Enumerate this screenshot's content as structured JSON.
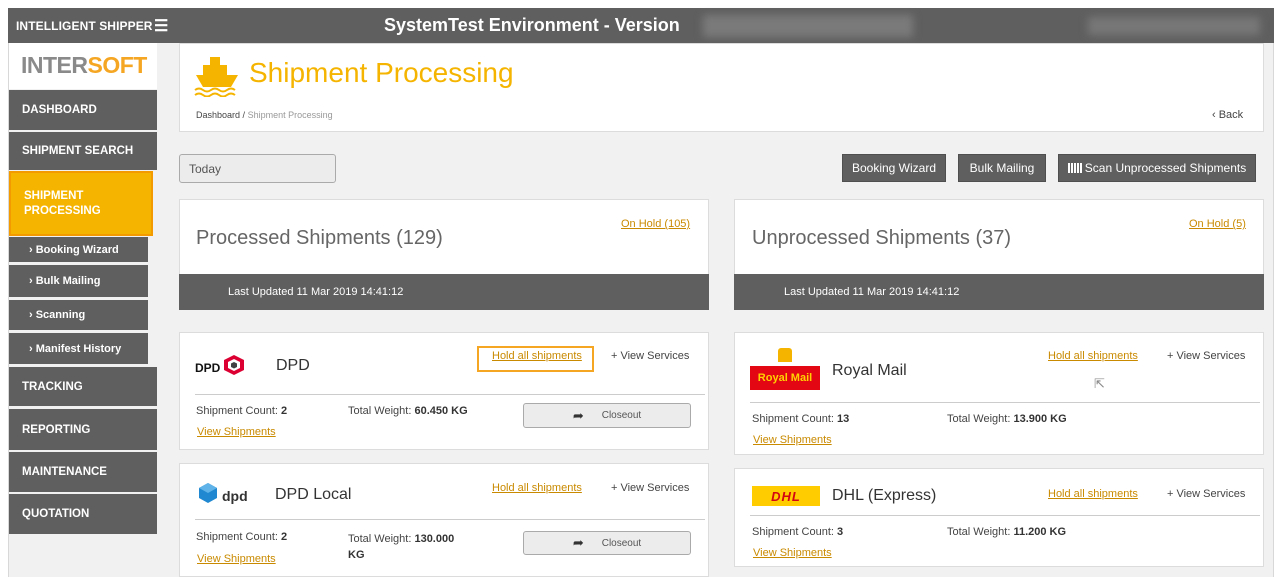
{
  "topbar": {
    "app_name": "INTELLIGENT SHIPPER",
    "menu_icon": "hamburger-icon",
    "env_title": "SystemTest Environment - Version"
  },
  "logo": {
    "part1": "INTER",
    "part2": "SOFT"
  },
  "sidebar": {
    "items": [
      {
        "label": "DASHBOARD"
      },
      {
        "label": "SHIPMENT SEARCH"
      },
      {
        "label": "SHIPMENT PROCESSING"
      },
      {
        "label": "TRACKING"
      },
      {
        "label": "REPORTING"
      },
      {
        "label": "MAINTENANCE"
      },
      {
        "label": "QUOTATION"
      }
    ],
    "subitems": [
      {
        "label": "› Booking Wizard"
      },
      {
        "label": "› Bulk Mailing"
      },
      {
        "label": "› Scanning"
      },
      {
        "label": "› Manifest History"
      }
    ]
  },
  "header": {
    "title": "Shipment Processing",
    "title_icon": "ship-icon",
    "breadcrumb_home": "Dashboard",
    "breadcrumb_sep": "/",
    "breadcrumb_current": "Shipment Processing",
    "back_label": "‹ Back"
  },
  "controls": {
    "date_value": "Today",
    "booking_wizard": "Booking Wizard",
    "bulk_mailing": "Bulk Mailing",
    "scan_unprocessed": "Scan Unprocessed Shipments"
  },
  "processed": {
    "title": "Processed Shipments (129)",
    "on_hold": "On Hold (105)",
    "last_updated": "Last Updated 11 Mar 2019 14:41:12"
  },
  "unprocessed": {
    "title": "Unprocessed Shipments (37)",
    "on_hold": "On Hold (5)",
    "last_updated": "Last Updated 11 Mar 2019 14:41:12"
  },
  "common": {
    "hold_all": "Hold all shipments",
    "view_services": "+ View Services",
    "view_shipments": "View Shipments",
    "closeout": "Closeout",
    "shipment_count_label": "Shipment Count:",
    "total_weight_label": "Total Weight:"
  },
  "carriers": {
    "dpd": {
      "logo_text": "DPD",
      "name": "DPD",
      "count": "2",
      "weight": "60.450 KG"
    },
    "dpd_local": {
      "logo_text": "dpd",
      "name": "DPD Local",
      "count": "2",
      "weight": "130.000",
      "weight_unit": "KG"
    },
    "royal_mail": {
      "logo_text": "Royal Mail",
      "name": "Royal Mail",
      "count": "13",
      "weight": "13.900 KG"
    },
    "dhl": {
      "logo_text": "DHL",
      "name": "DHL (Express)",
      "count": "3",
      "weight": "11.200 KG"
    }
  },
  "colors": {
    "accent": "#f5b400",
    "dark": "#5f5f5f",
    "link": "#c98a00"
  }
}
